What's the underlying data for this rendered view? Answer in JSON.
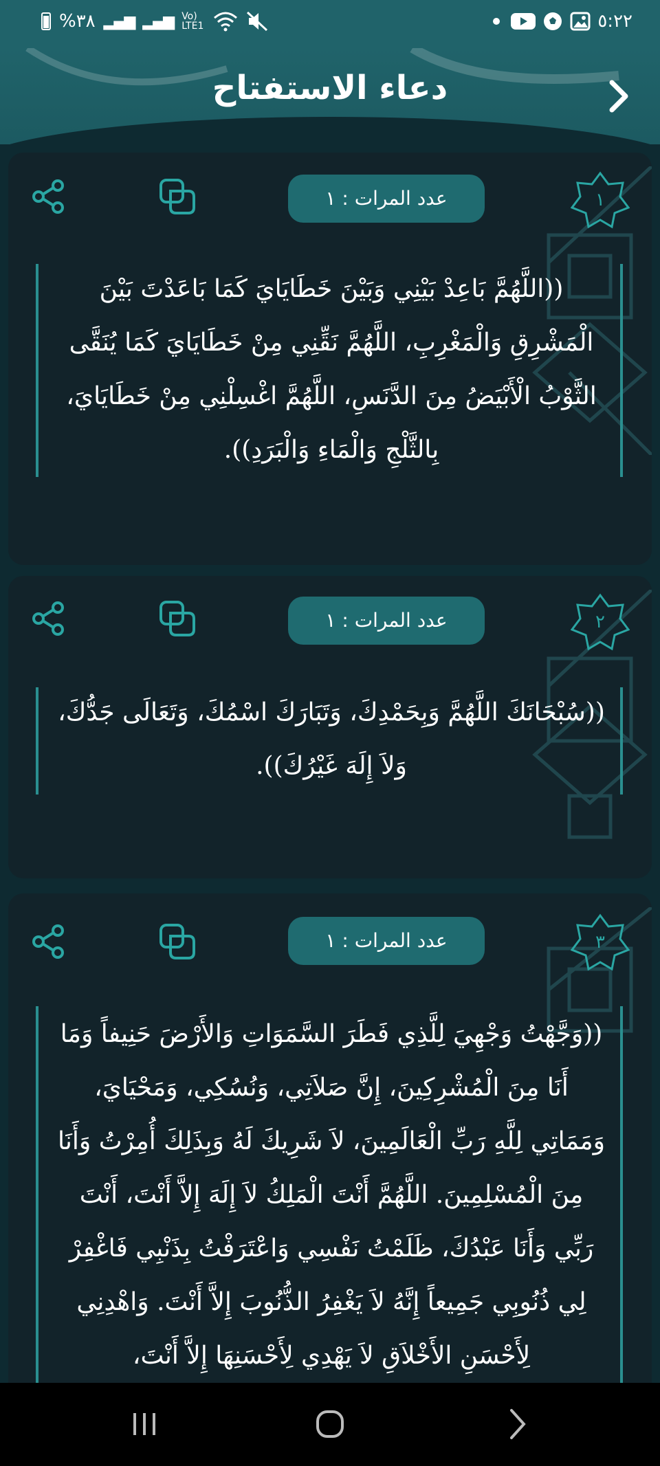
{
  "status_bar": {
    "battery_text": "%٣٨",
    "network_label": "Vo) LTE1",
    "time": "٥:٢٢"
  },
  "header": {
    "title": "دعاء الاستفتاح",
    "back_icon": "chevron-right-icon"
  },
  "cards": [
    {
      "number": "١",
      "count_label": "عدد المرات : ١",
      "text": "((اللَّهُمَّ بَاعِدْ بَيْنِي وَبَيْنَ خَطَايَايَ كَمَا بَاعَدْتَ بَيْنَ الْمَشْرِقِ وَالْمَغْرِبِ، اللَّهُمَّ نَقِّنِي مِنْ خَطَايَايَ كَمَا يُنَقَّى الثَّوْبُ الْأَبْيَضُ مِنَ الدَّنَسِ، اللَّهُمَّ اغْسِلْنِي مِنْ خَطَايَايَ، بِالثَّلْجِ وَالْمَاءِ وَالْبَرَدِ))."
    },
    {
      "number": "٢",
      "count_label": "عدد المرات : ١",
      "text": "((سُبْحَانَكَ اللَّهُمَّ وَبِحَمْدِكَ، وَتَبَارَكَ اسْمُكَ، وَتَعَالَى جَدُّكَ، وَلاَ إِلَهَ غَيْرُكَ))."
    },
    {
      "number": "٣",
      "count_label": "عدد المرات : ١",
      "text": "((وَجَّهْتُ وَجْهِيَ لِلَّذِي فَطَرَ السَّمَوَاتِ وَالأَرْضَ حَنِيفاً وَمَا أَنَا مِنَ الْمُشْرِكِينَ، إِنَّ صَلاَتِي، وَنُسُكِي، وَمَحْيَايَ، وَمَمَاتِي لِلَّهِ رَبِّ الْعَالَمِينَ، لاَ شَرِيكَ لَهُ وَبِذَلِكَ أُمِرْتُ وَأَنَا مِنَ الْمُسْلِمِينَ. اللَّهُمَّ أَنْتَ الْمَلِكُ لاَ إِلَهَ إِلاَّ أَنْتَ، أَنْتَ رَبِّي وَأَنَا عَبْدُكَ، ظَلَمْتُ نَفْسِي وَاعْتَرَفْتُ بِذَنْبِي فَاغْفِرْ لِي ذُنُوبِي جَمِيعاً إِنَّهُ لاَ يَغْفِرُ الذُّنُوبَ إِلاَّ أَنْتَ. وَاهْدِنِي لِأَحْسَنِ الأَخْلاَقِ لاَ يَهْدِي لِأَحْسَنِهَا إِلاَّ أَنْتَ،"
    }
  ],
  "colors": {
    "header": "#20636a",
    "background": "#0e2a31",
    "card": "#12232a",
    "pill": "#1f6b70",
    "accent": "#2a8f90"
  }
}
